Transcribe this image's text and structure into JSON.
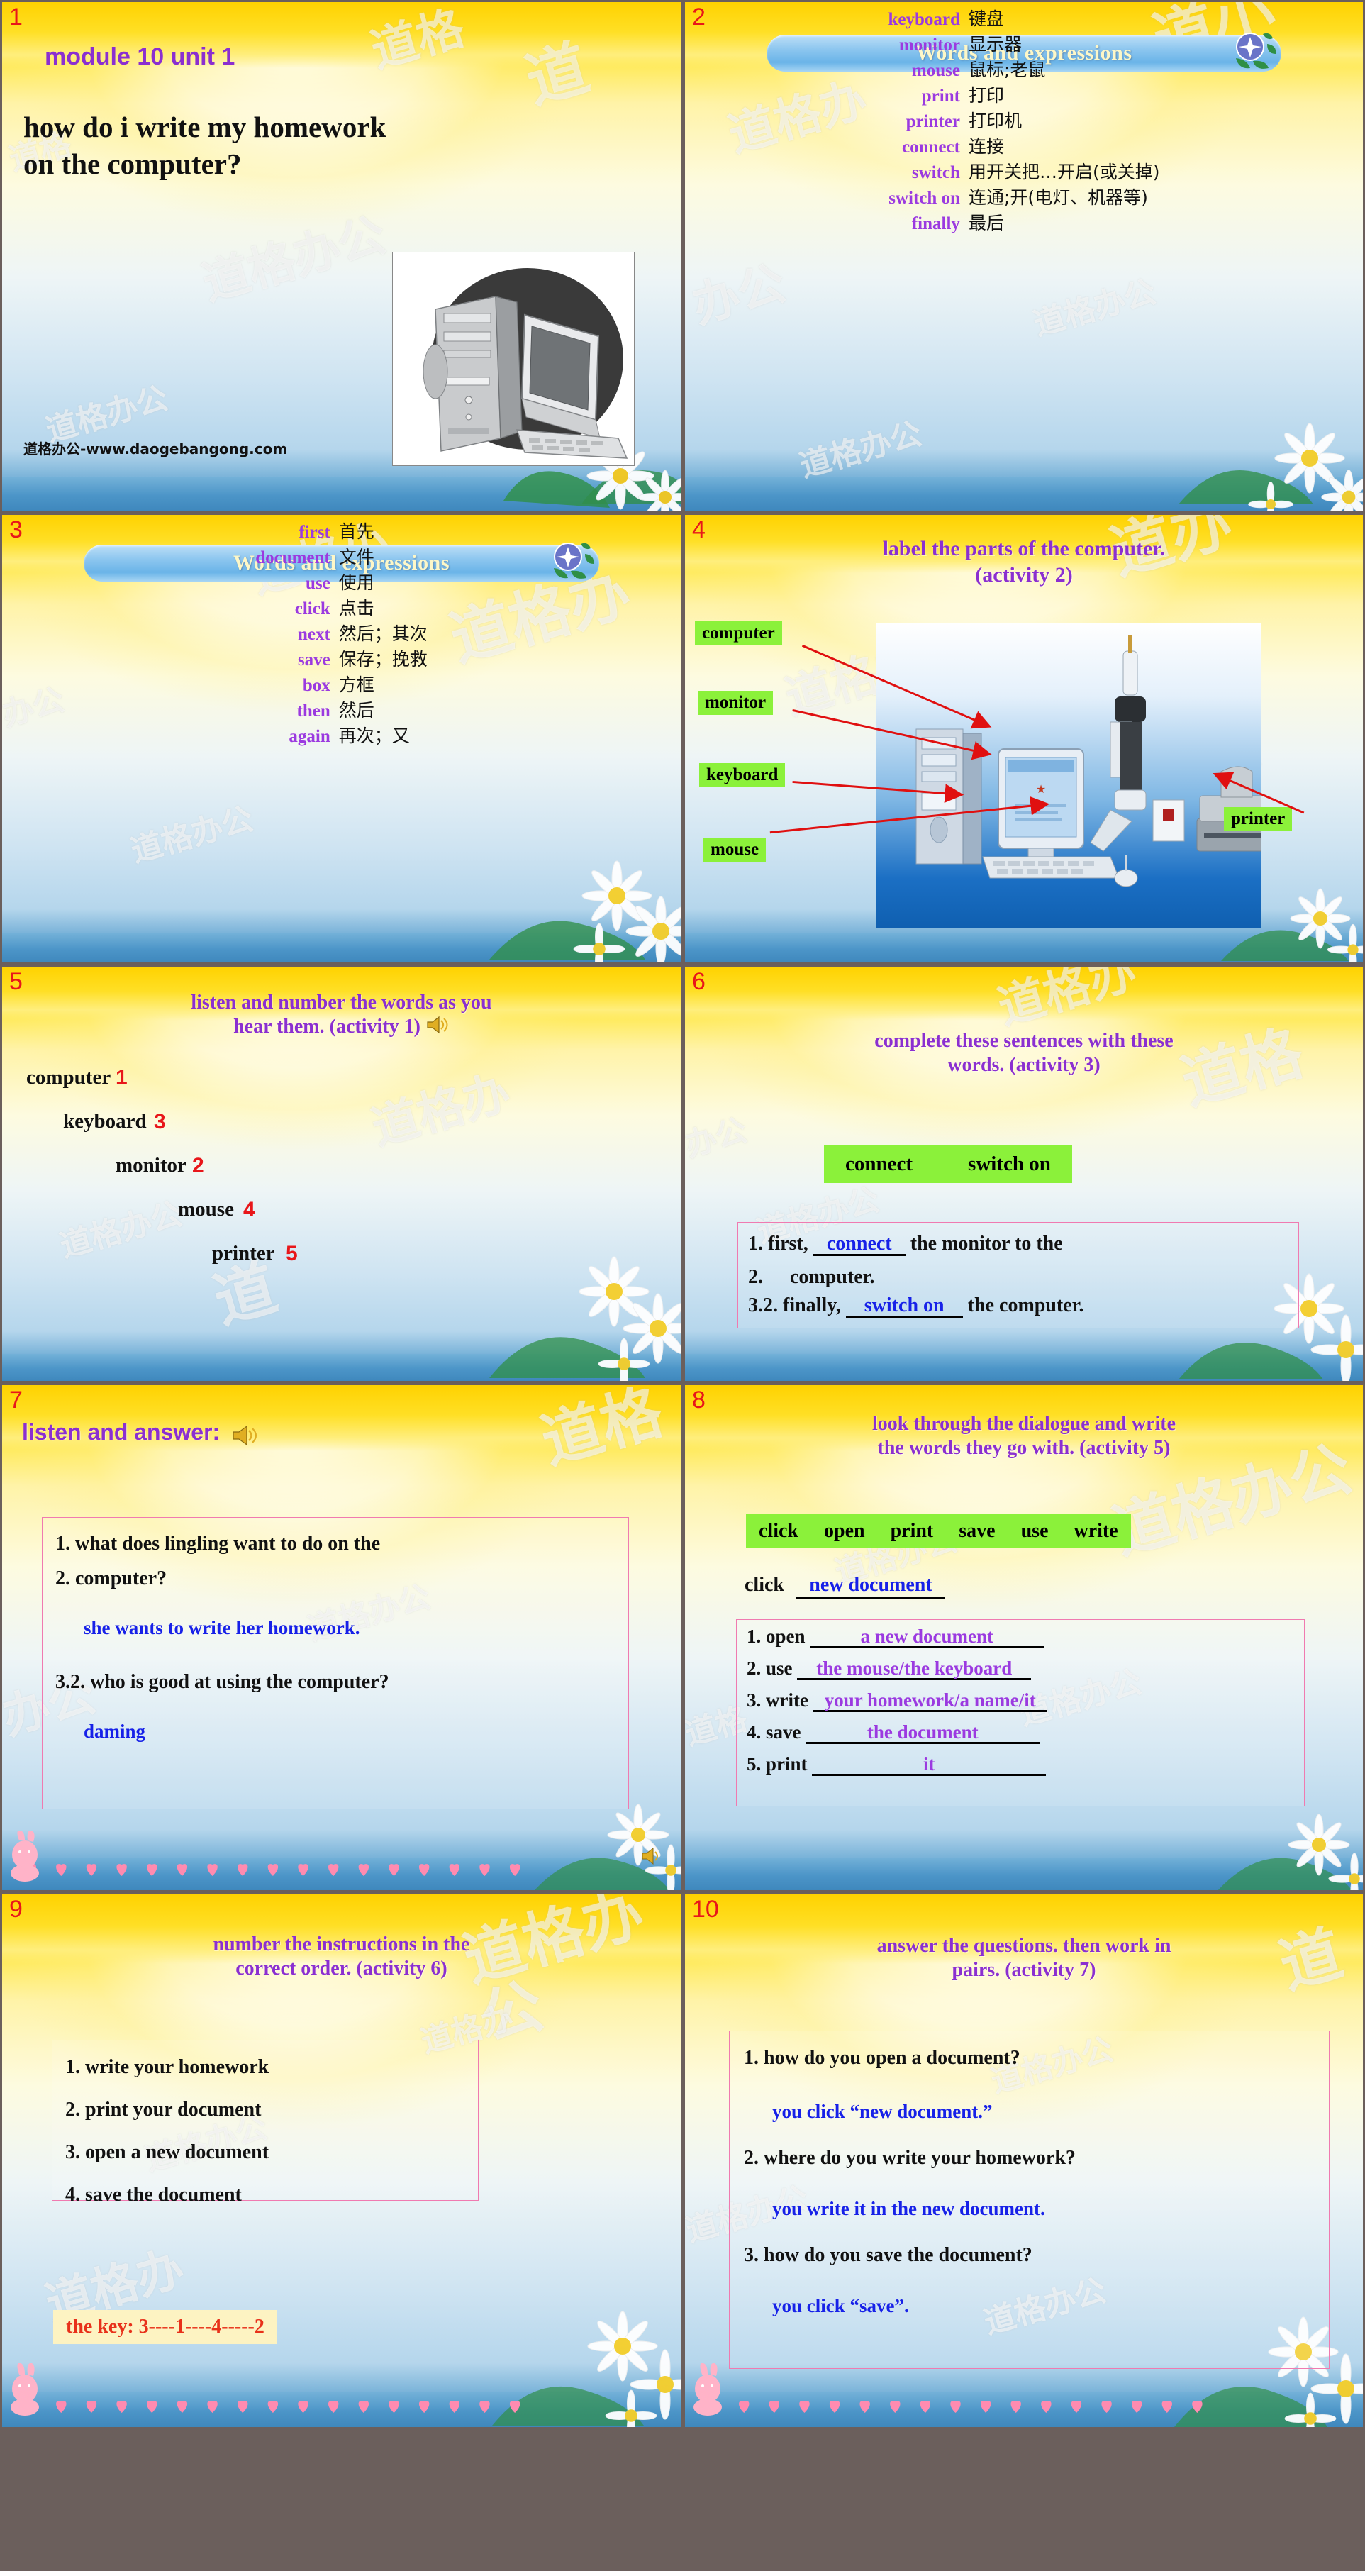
{
  "deck": {
    "watermark": "道格办公",
    "watermark_url": "道格办公-www.daogebangong.com"
  },
  "slides": [
    {
      "number": "1",
      "kind": "title",
      "subtitle": "module 10  unit 1",
      "title_line1": "how do i write my homework",
      "title_line2": "on the computer?",
      "footer": "道格办公-www.daogebangong.com",
      "image_alt": "computer-tower-and-monitor-photo"
    },
    {
      "number": "2",
      "kind": "vocab",
      "banner": "Words and expressions",
      "rows": [
        {
          "en": "keyboard",
          "cn": "键盘"
        },
        {
          "en": "monitor",
          "cn": "显示器"
        },
        {
          "en": "mouse",
          "cn": "鼠标;老鼠"
        },
        {
          "en": "print",
          "cn": "打印"
        },
        {
          "en": "printer",
          "cn": "打印机"
        },
        {
          "en": "connect",
          "cn": "连接"
        },
        {
          "en": "switch",
          "cn": "用开关把…开启(或关掉)"
        },
        {
          "en": "switch on",
          "cn": "连通;开(电灯、机器等)"
        },
        {
          "en": "finally",
          "cn": "最后"
        }
      ]
    },
    {
      "number": "3",
      "kind": "vocab",
      "banner": "Words and expressions",
      "rows": [
        {
          "en": "first",
          "cn": "首先"
        },
        {
          "en": "document",
          "cn": "文件"
        },
        {
          "en": "use",
          "cn": "使用"
        },
        {
          "en": "click",
          "cn": "点击"
        },
        {
          "en": "next",
          "cn": "然后；其次"
        },
        {
          "en": "save",
          "cn": "保存；挽救"
        },
        {
          "en": "box",
          "cn": "方框"
        },
        {
          "en": "then",
          "cn": "然后"
        },
        {
          "en": "again",
          "cn": "再次；又"
        }
      ]
    },
    {
      "number": "4",
      "kind": "label",
      "title_line1": "label the parts of the computer.",
      "title_line2": "(activity 2)",
      "labels": [
        "computer",
        "monitor",
        "keyboard",
        "mouse",
        "printer"
      ],
      "image_alt": "computer-workstation-photo"
    },
    {
      "number": "5",
      "kind": "numbering",
      "title_line1": "listen and number the words as you",
      "title_line2": "hear them. (activity 1)",
      "has_speaker": true,
      "items": [
        {
          "word": "computer",
          "num": "1"
        },
        {
          "word": "keyboard",
          "num": "3"
        },
        {
          "word": "monitor",
          "num": "2"
        },
        {
          "word": "mouse",
          "num": "4"
        },
        {
          "word": "printer",
          "num": "5"
        }
      ]
    },
    {
      "number": "6",
      "kind": "cloze",
      "title_line1": "complete these sentences with these",
      "title_line2": "words. (activity 3)",
      "wordbank": [
        "connect",
        "switch on"
      ],
      "lines": [
        {
          "pre": "1. first,",
          "answer": "connect",
          "post": "the monitor to the"
        },
        {
          "pre": "2.",
          "answer": "",
          "post": "computer."
        },
        {
          "pre": "3.2. finally,",
          "answer": "switch on",
          "post": "the computer."
        }
      ]
    },
    {
      "number": "7",
      "kind": "qa",
      "title": "listen and answer:",
      "has_speaker": true,
      "blocks": [
        {
          "q1": "1. what does lingling want to do on the",
          "q2": "2.    computer?",
          "a": "she wants to write her homework."
        },
        {
          "q1": "3.2. who is good at using the computer?",
          "q2": "",
          "a": "daming"
        }
      ],
      "has_hearts": true
    },
    {
      "number": "8",
      "kind": "collocation",
      "title_line1": "look through the dialogue and write",
      "title_line2": "the words they go with. (activity 5)",
      "wordbank": [
        "click",
        "open",
        "print",
        "save",
        "use",
        "write"
      ],
      "example": {
        "verb": "click",
        "answer": "new document"
      },
      "rows": [
        {
          "n": "1.",
          "verb": "open",
          "answer": "a new document"
        },
        {
          "n": "2.",
          "verb": "use",
          "answer": "the mouse/the keyboard"
        },
        {
          "n": "3.",
          "verb": "write",
          "answer": "your homework/a name/it"
        },
        {
          "n": "4.",
          "verb": "save",
          "answer": "the document"
        },
        {
          "n": "5.",
          "verb": "print",
          "answer": "it"
        }
      ]
    },
    {
      "number": "9",
      "kind": "ordering",
      "title_line1": "number the instructions in the",
      "title_line2": "correct order. (activity 6)",
      "items": [
        "1. write your homework",
        "2. print your document",
        "3. open a new document",
        "4. save the document"
      ],
      "key": "the key: 3----1----4-----2",
      "has_hearts": true
    },
    {
      "number": "10",
      "kind": "qa",
      "title_line1": "answer the questions. then work in",
      "title_line2": "pairs. (activity 7)",
      "pairs": [
        {
          "q": "1. how do you open a document?",
          "a": "you click “new document.”"
        },
        {
          "q": "2. where do you write your homework?",
          "a": "you write it in the new document."
        },
        {
          "q": "3. how do you save the document?",
          "a": "you click “save”."
        }
      ],
      "has_hearts": true
    }
  ]
}
